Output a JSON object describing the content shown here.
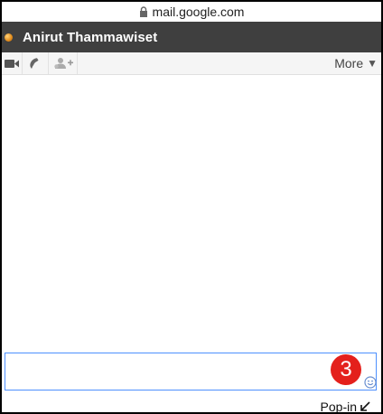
{
  "browser": {
    "url": "mail.google.com"
  },
  "chat": {
    "contact_name": "Anirut Thammawiset",
    "toolbar": {
      "more_label": "More",
      "more_arrow": "▼"
    },
    "compose": {
      "value": "",
      "placeholder": ""
    },
    "badge_count": "3",
    "popin_label": "Pop-in"
  },
  "colors": {
    "titlebar_bg": "#3f3f3f",
    "badge_red": "#e4201c",
    "compose_border": "#4d90fe"
  }
}
